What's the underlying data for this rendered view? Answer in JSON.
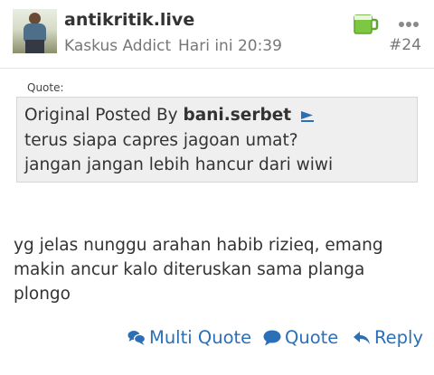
{
  "post": {
    "username": "antikritik.live",
    "rank": "Kaskus Addict",
    "time": "Hari ini 20:39",
    "number": "#24"
  },
  "quote": {
    "label": "Quote:",
    "prefix": "Original Posted By ",
    "author": "bani.serbet",
    "lines": [
      "terus siapa capres jagoan umat?",
      "jangan jangan lebih hancur dari wiwi"
    ]
  },
  "message": {
    "text": "yg jelas nunggu arahan habib rizieq, emang makin ancur kalo diteruskan sama planga plongo"
  },
  "actions": {
    "multi_quote": "Multi Quote",
    "quote": "Quote",
    "reply": "Reply"
  },
  "colors": {
    "accent": "#2b6fb7",
    "quote_bg": "#efefef",
    "post_icon": "#7dc742"
  },
  "icons": {
    "avatar": "user-avatar",
    "post_status": "beer-mug-icon",
    "more": "more-dots-icon",
    "goto": "goto-post-arrow-icon",
    "multi_quote": "multi-quote-bubbles-icon",
    "quote": "quote-bubble-icon",
    "reply": "reply-arrow-icon"
  }
}
